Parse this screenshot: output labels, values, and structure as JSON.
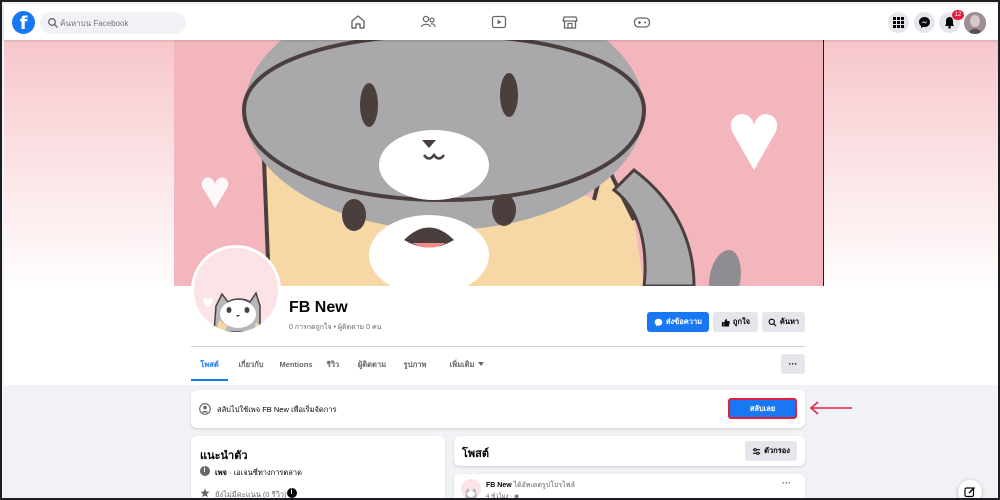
{
  "search": {
    "placeholder": "ค้นหาบน Facebook"
  },
  "notifications": {
    "count": "12"
  },
  "page": {
    "name": "FB New",
    "meta": "0 การกดถูกใจ • ผู้ติดตาม 0 คน"
  },
  "actions": {
    "message": "ส่งข้อความ",
    "like": "ถูกใจ",
    "search": "ค้นหา"
  },
  "tabs": [
    "โพสต์",
    "เกี่ยวกับ",
    "Mentions",
    "รีวิว",
    "ผู้ติดตาม",
    "รูปภาพ",
    "เพิ่มเติม"
  ],
  "switch_banner": {
    "text": "สลับไปใช้เพจ FB New เพื่อเริ่มจัดการ",
    "button": "สลับเลย"
  },
  "intro": {
    "title": "แนะนำตัว",
    "page_type_bold": "เพจ",
    "page_type_rest": " · เอเจนซี่ทางการตลาด",
    "rating": "ยังไม่มีคะแนน (0 รีวิว)"
  },
  "posts": {
    "title": "โพสต์",
    "filter": "ตัวกรอง",
    "post_author": "FB New",
    "post_action": " ได้อัพเดตรูปโปรไฟล์",
    "post_time": "4 ชั่วโมง · ",
    "more": "···"
  },
  "colors": {
    "brand_blue": "#1877f2",
    "highlight_red": "#e41e3f",
    "cover_pink": "#f4b6bd"
  },
  "icons": {
    "nav_center": [
      "home-icon",
      "friends-icon",
      "watch-icon",
      "marketplace-icon",
      "gaming-icon"
    ],
    "nav_right": [
      "menu-grid-icon",
      "messenger-icon",
      "bell-icon"
    ]
  }
}
